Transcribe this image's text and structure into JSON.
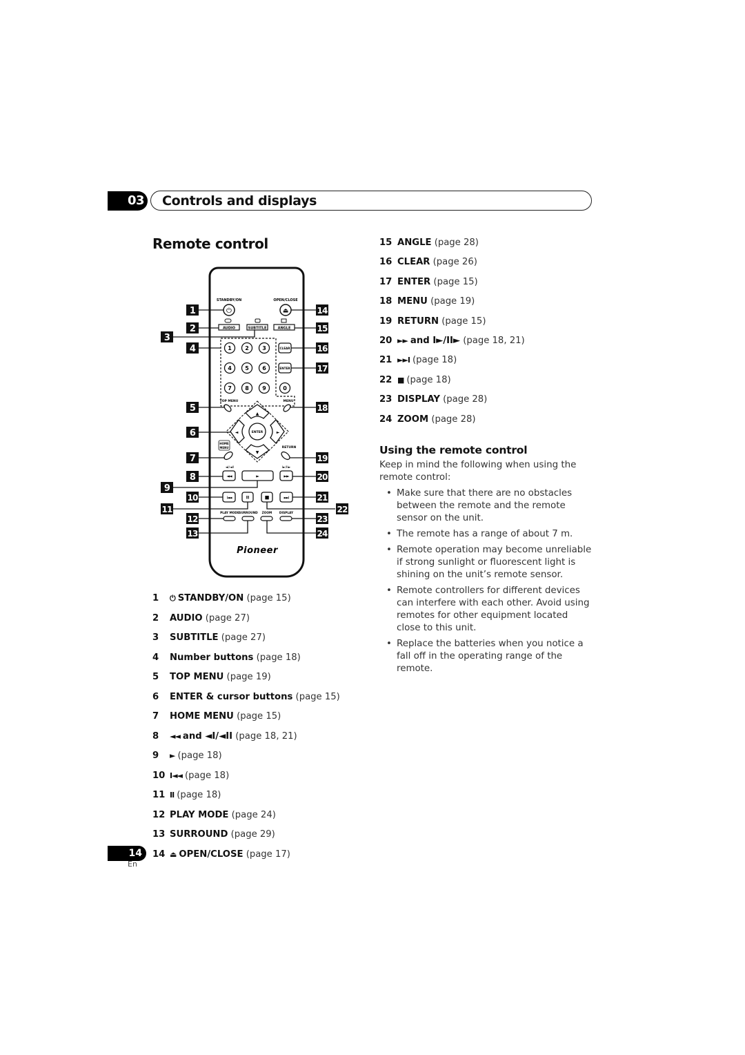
{
  "chapter": {
    "number": "03",
    "title": "Controls and displays"
  },
  "section_title": "Remote control",
  "remote": {
    "brand": "Pioneer",
    "labels": {
      "standby_on": "STANDBY/ON",
      "open_close": "OPEN/CLOSE",
      "audio": "AUDIO",
      "subtitle": "SUBTITLE",
      "angle": "ANGLE",
      "clear": "CLEAR",
      "enter_side": "ENTER",
      "enter_center": "ENTER",
      "top_menu": "TOP MENU",
      "menu": "MENU",
      "home_menu_1": "HOME",
      "home_menu_2": "MENU",
      "return": "RETURN",
      "rev_step": "◄I/◄II",
      "fwd_step": "I►/II►",
      "play_mode": "PLAY MODE",
      "surround": "SURROUND",
      "zoom": "ZOOM",
      "display": "DISPLAY"
    },
    "number_keys": [
      "1",
      "2",
      "3",
      "4",
      "5",
      "6",
      "7",
      "8",
      "9",
      "0"
    ],
    "glyphs": {
      "power": "⏻",
      "eject": "⏏",
      "up": "▲",
      "down": "▼",
      "left": "◄",
      "right": "►",
      "rew": "◄◄",
      "play": "►",
      "ff": "►►",
      "prev": "I◄◄",
      "pause": "II",
      "stop": "■",
      "next": "►►I"
    },
    "callouts": [
      "1",
      "2",
      "3",
      "4",
      "5",
      "6",
      "7",
      "8",
      "9",
      "10",
      "11",
      "12",
      "13",
      "14",
      "15",
      "16",
      "17",
      "18",
      "19",
      "20",
      "21",
      "22",
      "23",
      "24"
    ]
  },
  "left_list": [
    {
      "num": "1",
      "glyph": "⏻",
      "label": "STANDBY/ON",
      "page": "(page 15)"
    },
    {
      "num": "2",
      "glyph": "",
      "label": "AUDIO",
      "page": "(page 27)"
    },
    {
      "num": "3",
      "glyph": "",
      "label": "SUBTITLE",
      "page": "(page 27)"
    },
    {
      "num": "4",
      "glyph": "",
      "label": "Number buttons",
      "page": "(page 18)"
    },
    {
      "num": "5",
      "glyph": "",
      "label": "TOP MENU",
      "page": "(page 19)"
    },
    {
      "num": "6",
      "glyph": "",
      "label": "ENTER & cursor buttons",
      "page": "(page 15)"
    },
    {
      "num": "7",
      "glyph": "",
      "label": "HOME MENU",
      "page": "(page 15)"
    },
    {
      "num": "8",
      "glyph": "◄◄",
      "label": "and ◄I/◄II",
      "page": "(page 18, 21)"
    },
    {
      "num": "9",
      "glyph": "►",
      "label": "",
      "page": "(page 18)"
    },
    {
      "num": "10",
      "glyph": "I◄◄",
      "label": "",
      "page": "(page 18)"
    },
    {
      "num": "11",
      "glyph": "II",
      "label": "",
      "page": "(page 18)"
    },
    {
      "num": "12",
      "glyph": "",
      "label": "PLAY MODE",
      "page": "(page 24)"
    },
    {
      "num": "13",
      "glyph": "",
      "label": "SURROUND",
      "page": "(page 29)"
    },
    {
      "num": "14",
      "glyph": "⏏",
      "label": "OPEN/CLOSE",
      "page": "(page 17)"
    }
  ],
  "right_list": [
    {
      "num": "15",
      "glyph": "",
      "label": "ANGLE",
      "page": "(page 28)"
    },
    {
      "num": "16",
      "glyph": "",
      "label": "CLEAR",
      "page": "(page 26)"
    },
    {
      "num": "17",
      "glyph": "",
      "label": "ENTER",
      "page": "(page 15)"
    },
    {
      "num": "18",
      "glyph": "",
      "label": "MENU",
      "page": "(page 19)"
    },
    {
      "num": "19",
      "glyph": "",
      "label": "RETURN",
      "page": "(page 15)"
    },
    {
      "num": "20",
      "glyph": "►►",
      "label": "and I►/II►",
      "page": "(page 18, 21)"
    },
    {
      "num": "21",
      "glyph": "►►I",
      "label": "",
      "page": "(page 18)"
    },
    {
      "num": "22",
      "glyph": "■",
      "label": "",
      "page": "(page 18)"
    },
    {
      "num": "23",
      "glyph": "",
      "label": "DISPLAY",
      "page": "(page 28)"
    },
    {
      "num": "24",
      "glyph": "",
      "label": "ZOOM",
      "page": "(page 28)"
    }
  ],
  "using": {
    "title": "Using the remote control",
    "intro": "Keep in mind the following when using the remote control:",
    "bullets": [
      "Make sure that there are no obstacles between the remote and the remote sensor on the unit.",
      "The remote has a range of about 7 m.",
      "Remote operation may become unreliable if strong sunlight or fluorescent light is shining on the unit’s remote sensor.",
      "Remote controllers for different devices can interfere with each other. Avoid using remotes for other equipment located close to this unit.",
      "Replace the batteries when you notice a fall off in the operating range of the remote."
    ]
  },
  "footer": {
    "page_number": "14",
    "language": "En"
  }
}
